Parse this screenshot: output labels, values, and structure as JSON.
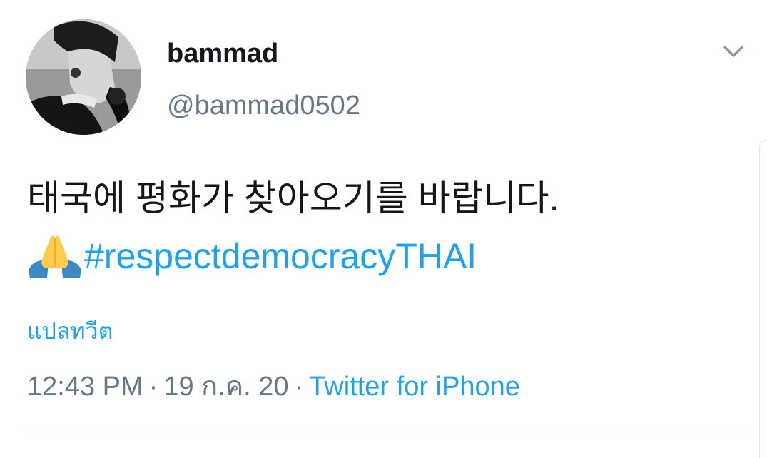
{
  "user": {
    "display_name": "bammad",
    "handle": "@bammad0502"
  },
  "tweet": {
    "text_line1": "태국에 평화가 찾아오기를 바랍니다.",
    "emoji": "🙏",
    "hashtag": "#respectdemocracyTHAI",
    "translate_label": "แปลทวีต",
    "time": "12:43 PM",
    "separator": "·",
    "date": "19 ก.ค. 20",
    "source": "Twitter for iPhone"
  },
  "icons": {
    "menu": "chevron-down-icon",
    "emoji": "folded-hands-icon"
  },
  "colors": {
    "link": "#1da1f2",
    "secondary_text": "#657786",
    "primary_text": "#14171a",
    "divider": "#e1e8ed"
  }
}
